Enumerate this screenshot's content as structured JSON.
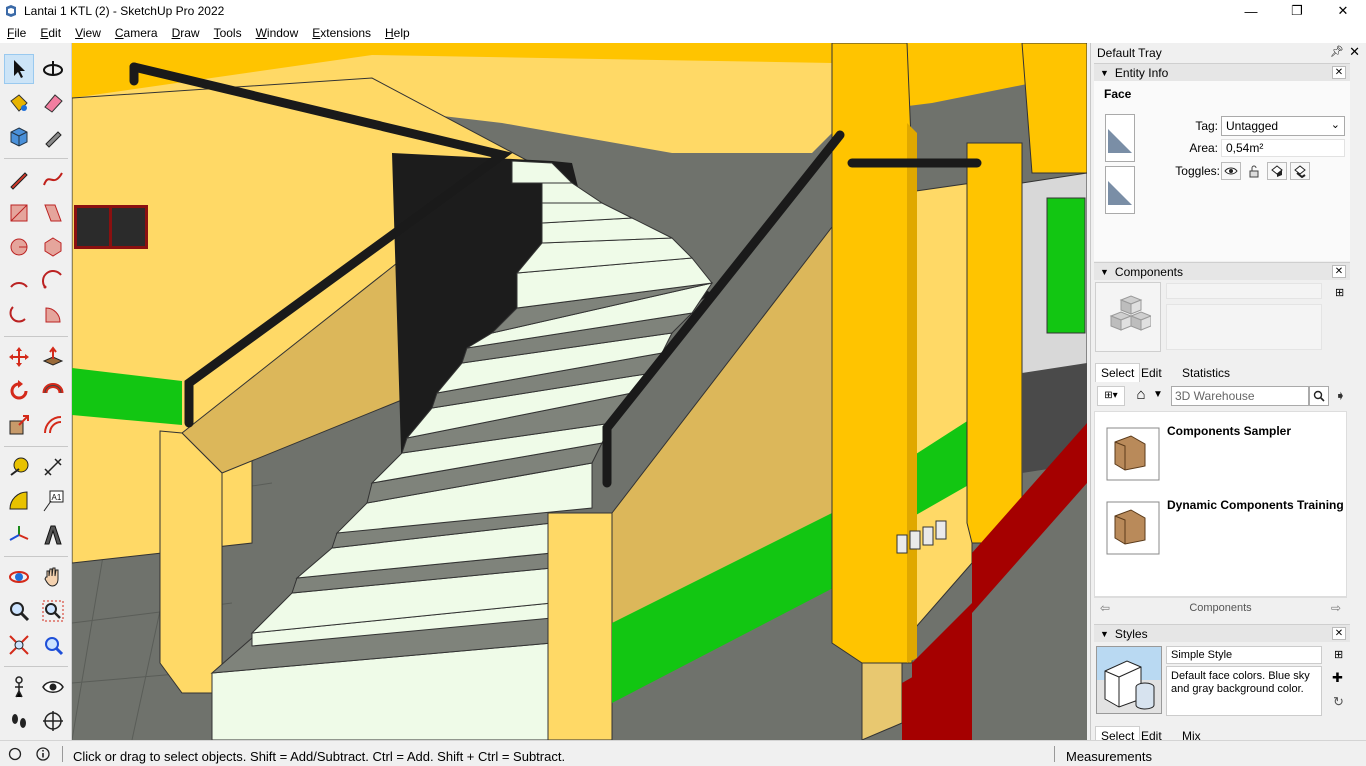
{
  "window": {
    "title": "Lantai 1 KTL (2) - SketchUp Pro 2022",
    "minimize": "—",
    "maximize": "❐",
    "close": "✕"
  },
  "menu": [
    "File",
    "Edit",
    "View",
    "Camera",
    "Draw",
    "Tools",
    "Window",
    "Extensions",
    "Help"
  ],
  "toolbar": {
    "active_tool": "select-tool",
    "tools": [
      "select",
      "orbit",
      "paint-bucket",
      "eraser",
      "make-component",
      "tag",
      "line",
      "freehand",
      "rectangle",
      "rotated-rectangle",
      "circle",
      "polygon",
      "arc",
      "3pt-arc",
      "2pt-arc",
      "pie",
      "move",
      "push-pull",
      "rotate",
      "follow-me",
      "scale",
      "offset",
      "tape-measure",
      "dimensions",
      "protractor",
      "text",
      "axes",
      "3d-text",
      "orbit-view",
      "pan",
      "zoom",
      "zoom-window",
      "zoom-extents",
      "previous-view",
      "position-camera",
      "look-around",
      "walk",
      "section-plane"
    ],
    "text_tool_label": "A1"
  },
  "tray": {
    "title": "Default Tray",
    "pin_icon": "pin-icon",
    "entity_info": {
      "header": "Entity Info",
      "entity_type": "Face",
      "tag_label": "Tag:",
      "tag_value": "Untagged",
      "area_label": "Area:",
      "area_value": "0,54m²",
      "toggles_label": "Toggles:"
    },
    "components": {
      "header": "Components",
      "tabs": [
        "Select",
        "Edit",
        "Statistics"
      ],
      "selected_tab": "Select",
      "search_placeholder": "3D Warehouse",
      "collections": [
        "Components Sampler",
        "Dynamic Components Training"
      ],
      "nav_label": "Components"
    },
    "styles": {
      "header": "Styles",
      "style_name": "Simple Style",
      "style_description": "Default face colors. Blue sky and gray background color.",
      "tabs": [
        "Select",
        "Edit",
        "Mix"
      ],
      "selected_tab": "Select"
    }
  },
  "status": {
    "hint": "Click or drag to select objects. Shift = Add/Subtract. Ctrl = Add. Shift + Ctrl = Subtract.",
    "measurements_label": "Measurements",
    "measurements_value": ""
  },
  "colors": {
    "wall_yellow": "#ffd966",
    "wall_tan": "#dcb75a",
    "pillar_yellow": "#ffc400",
    "green_band": "#12c612",
    "floor_gray": "#6f726c",
    "tread_gray": "#7f837b",
    "riser_mint": "#effbe8",
    "red_base": "#a50000"
  }
}
